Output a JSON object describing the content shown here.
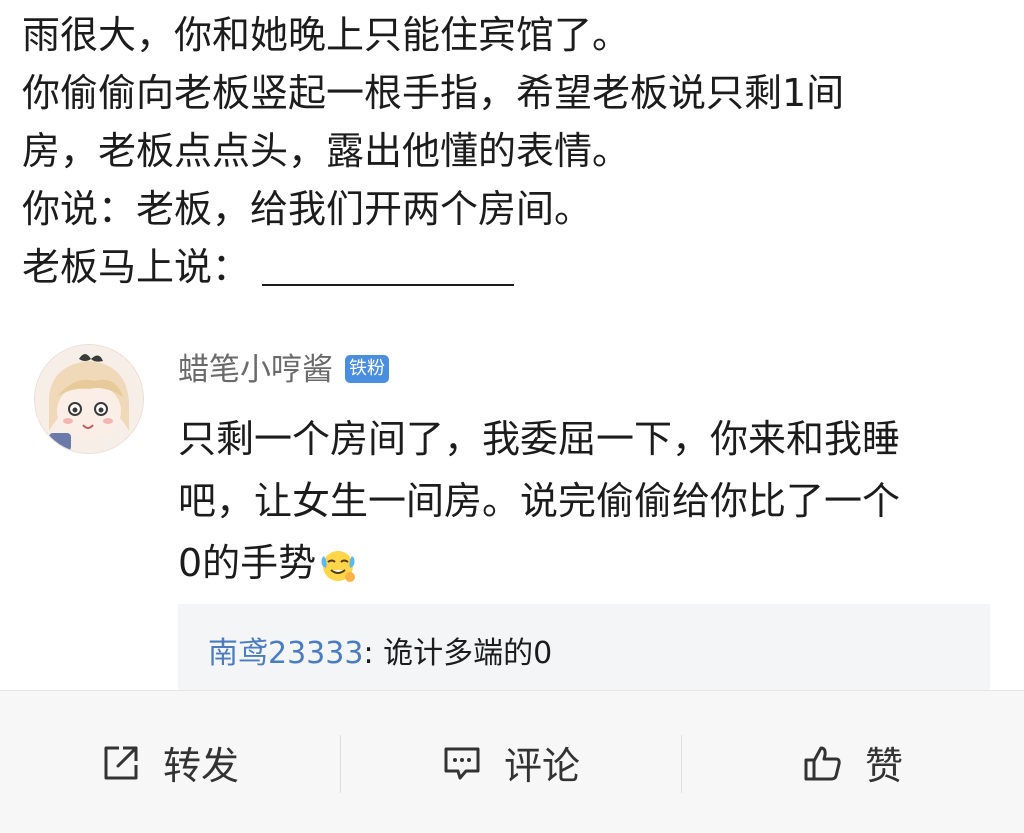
{
  "post": {
    "lines": [
      "雨很大，你和她晚上只能住宾馆了。",
      "你偷偷向老板竖起一根手指，希望老板说只剩1间",
      "房，老板点点头，露出他懂的表情。",
      "你说：老板，给我们开两个房间。",
      "老板马上说："
    ]
  },
  "comment": {
    "author": "蜡笔小哼酱",
    "badge": "铁粉",
    "lines": [
      "只剩一个房间了，我委屈一下，你来和我睡",
      "吧，让女生一间房。说完偷偷给你比了一个",
      "0的手势"
    ],
    "emoji": "crying-laughing-emoji",
    "reply": {
      "user": "南鸢23333",
      "separator": ":",
      "text": " 诡计多端的0"
    }
  },
  "actions": {
    "repost": {
      "label": "转发",
      "icon": "share-icon"
    },
    "comment": {
      "label": "评论",
      "icon": "comment-icon"
    },
    "like": {
      "label": "赞",
      "icon": "thumbs-up-icon"
    }
  },
  "colors": {
    "badge": "#4a8ee0",
    "reply_user": "#4a7cbf",
    "action_bar": "#f7f7f7"
  }
}
